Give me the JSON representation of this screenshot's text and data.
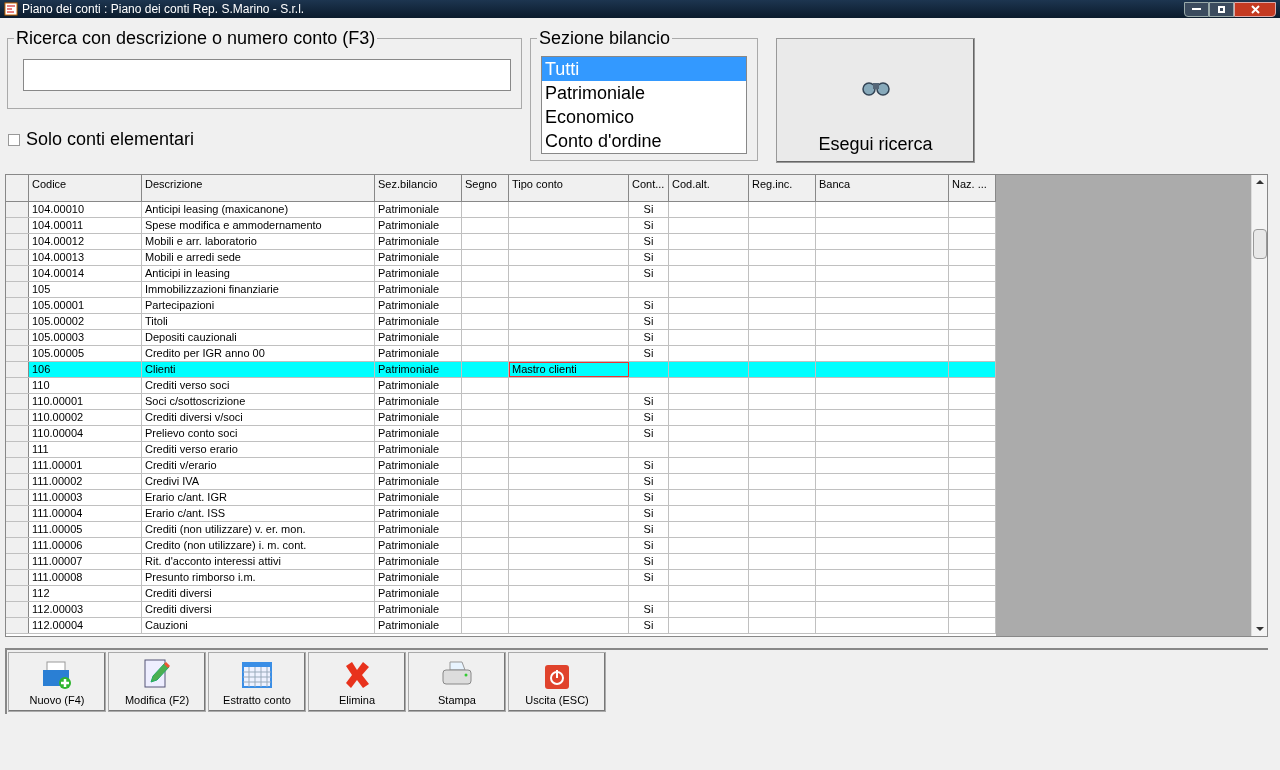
{
  "window": {
    "title": "Piano dei conti : Piano dei conti Rep. S.Marino - S.r.l."
  },
  "search": {
    "legend": "Ricerca con descrizione o numero conto (F3)"
  },
  "only_elementary": {
    "label": "Solo conti elementari",
    "checked": false
  },
  "section": {
    "legend": "Sezione bilancio",
    "items": [
      {
        "label": "Tutti",
        "selected": true
      },
      {
        "label": "Patrimoniale",
        "selected": false
      },
      {
        "label": "Economico",
        "selected": false
      },
      {
        "label": "Conto d'ordine",
        "selected": false
      }
    ]
  },
  "search_button": {
    "label": "Esegui ricerca"
  },
  "table": {
    "columns": [
      "Codice",
      "Descrizione",
      "Sez.bilancio",
      "Segno",
      "Tipo conto",
      "Cont...",
      "Cod.alt.",
      "Reg.inc.",
      "Banca",
      "Naz. ..."
    ],
    "rows": [
      {
        "codice": "104.00010",
        "descrizione": "Anticipi leasing (maxicanone)",
        "sez": "Patrimoniale",
        "cont": "Si",
        "selected": false
      },
      {
        "codice": "104.00011",
        "descrizione": "Spese modifica e ammodernamento",
        "sez": "Patrimoniale",
        "cont": "Si",
        "selected": false
      },
      {
        "codice": "104.00012",
        "descrizione": "Mobili e arr. laboratorio",
        "sez": "Patrimoniale",
        "cont": "Si",
        "selected": false
      },
      {
        "codice": "104.00013",
        "descrizione": "Mobili e arredi sede",
        "sez": "Patrimoniale",
        "cont": "Si",
        "selected": false
      },
      {
        "codice": "104.00014",
        "descrizione": "Anticipi in leasing",
        "sez": "Patrimoniale",
        "cont": "Si",
        "selected": false
      },
      {
        "codice": "105",
        "descrizione": "Immobilizzazioni finanziarie",
        "sez": "Patrimoniale",
        "selected": false
      },
      {
        "codice": "105.00001",
        "descrizione": "Partecipazioni",
        "sez": "Patrimoniale",
        "cont": "Si",
        "selected": false
      },
      {
        "codice": "105.00002",
        "descrizione": "Titoli",
        "sez": "Patrimoniale",
        "cont": "Si",
        "selected": false
      },
      {
        "codice": "105.00003",
        "descrizione": "Depositi cauzionali",
        "sez": "Patrimoniale",
        "cont": "Si",
        "selected": false
      },
      {
        "codice": "105.00005",
        "descrizione": "Credito per IGR anno 00",
        "sez": "Patrimoniale",
        "cont": "Si",
        "selected": false
      },
      {
        "codice": "106",
        "descrizione": "Clienti",
        "sez": "Patrimoniale",
        "tipo": "Mastro clienti",
        "selected": true
      },
      {
        "codice": "110",
        "descrizione": "Crediti verso soci",
        "sez": "Patrimoniale",
        "selected": false
      },
      {
        "codice": "110.00001",
        "descrizione": "Soci c/sottoscrizione",
        "sez": "Patrimoniale",
        "cont": "Si",
        "selected": false
      },
      {
        "codice": "110.00002",
        "descrizione": "Crediti diversi v/soci",
        "sez": "Patrimoniale",
        "cont": "Si",
        "selected": false
      },
      {
        "codice": "110.00004",
        "descrizione": "Prelievo conto soci",
        "sez": "Patrimoniale",
        "cont": "Si",
        "selected": false
      },
      {
        "codice": "111",
        "descrizione": "Crediti verso erario",
        "sez": "Patrimoniale",
        "selected": false
      },
      {
        "codice": "111.00001",
        "descrizione": "Crediti v/erario",
        "sez": "Patrimoniale",
        "cont": "Si",
        "selected": false
      },
      {
        "codice": "111.00002",
        "descrizione": "Credivi IVA",
        "sez": "Patrimoniale",
        "cont": "Si",
        "selected": false
      },
      {
        "codice": "111.00003",
        "descrizione": "Erario c/ant. IGR",
        "sez": "Patrimoniale",
        "cont": "Si",
        "selected": false
      },
      {
        "codice": "111.00004",
        "descrizione": "Erario c/ant. ISS",
        "sez": "Patrimoniale",
        "cont": "Si",
        "selected": false
      },
      {
        "codice": "111.00005",
        "descrizione": "Crediti (non utilizzare) v. er. mon.",
        "sez": "Patrimoniale",
        "cont": "Si",
        "selected": false
      },
      {
        "codice": "111.00006",
        "descrizione": "Credito (non utilizzare) i. m. cont.",
        "sez": "Patrimoniale",
        "cont": "Si",
        "selected": false
      },
      {
        "codice": "111.00007",
        "descrizione": "Rit. d'acconto interessi attivi",
        "sez": "Patrimoniale",
        "cont": "Si",
        "selected": false
      },
      {
        "codice": "111.00008",
        "descrizione": "Presunto rimborso i.m.",
        "sez": "Patrimoniale",
        "cont": "Si",
        "selected": false
      },
      {
        "codice": "112",
        "descrizione": "Crediti diversi",
        "sez": "Patrimoniale",
        "selected": false
      },
      {
        "codice": "112.00003",
        "descrizione": "Crediti diversi",
        "sez": "Patrimoniale",
        "cont": "Si",
        "selected": false
      },
      {
        "codice": "112.00004",
        "descrizione": "Cauzioni",
        "sez": "Patrimoniale",
        "cont": "Si",
        "selected": false
      }
    ]
  },
  "toolbar": [
    {
      "label": "Nuovo (F4)",
      "kind": "new"
    },
    {
      "label": "Modifica (F2)",
      "kind": "edit"
    },
    {
      "label": "Estratto conto",
      "kind": "calendar"
    },
    {
      "label": "Elimina",
      "kind": "delete"
    },
    {
      "label": "Stampa",
      "kind": "print"
    },
    {
      "label": "Uscita (ESC)",
      "kind": "exit"
    }
  ]
}
